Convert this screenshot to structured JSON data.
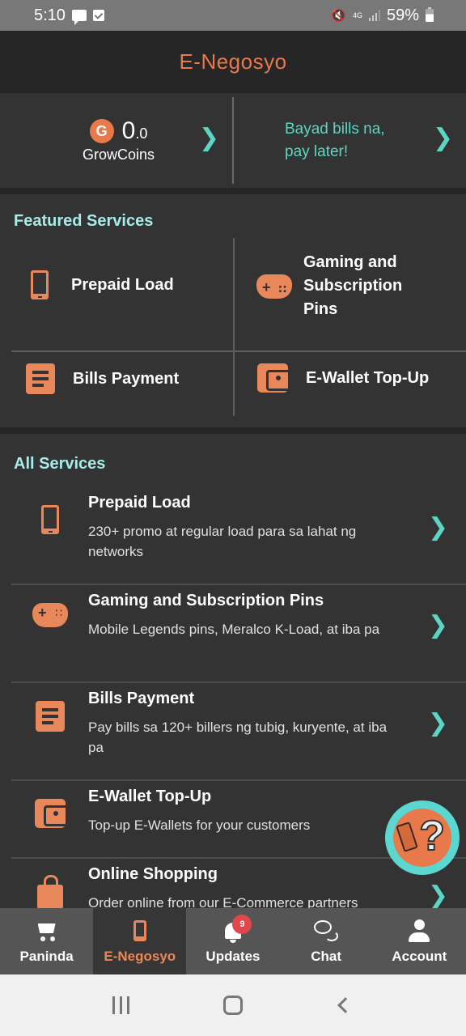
{
  "status_bar": {
    "time": "5:10",
    "network": "4G",
    "battery": "59%"
  },
  "header": {
    "title": "E-Negosyo"
  },
  "promo": {
    "coins_icon_letter": "G",
    "coins_value": "0",
    "coins_decimal": ".0",
    "coins_label": "GrowCoins",
    "paylater_text": "Bayad bills na,\npay later!"
  },
  "featured": {
    "title": "Featured Services",
    "items": [
      {
        "label": "Prepaid Load",
        "icon": "phone-icon"
      },
      {
        "label": "Gaming and\nSubscription\nPins",
        "icon": "gamepad-icon"
      },
      {
        "label": "Bills Payment",
        "icon": "bills-icon"
      },
      {
        "label": "E-Wallet Top-Up",
        "icon": "wallet-icon"
      }
    ]
  },
  "all_services": {
    "title": "All Services",
    "items": [
      {
        "title": "Prepaid Load",
        "desc": "230+ promo at regular load para sa lahat ng networks",
        "icon": "phone-icon"
      },
      {
        "title": "Gaming and Subscription Pins",
        "desc": "Mobile Legends pins, Meralco K-Load, at iba pa",
        "icon": "gamepad-icon"
      },
      {
        "title": "Bills Payment",
        "desc": "Pay bills sa 120+ billers ng tubig, kuryente, at iba pa",
        "icon": "bills-icon"
      },
      {
        "title": "E-Wallet Top-Up",
        "desc": "Top-up E-Wallets for your customers",
        "icon": "wallet-icon"
      },
      {
        "title": "Online Shopping",
        "desc": "Order online from our E-Commerce partners",
        "icon": "shopping-bag-icon"
      }
    ]
  },
  "help_fab": {
    "icon": "help-question-icon"
  },
  "bottom_nav": {
    "active": "E-Negosyo",
    "items": [
      {
        "label": "Paninda",
        "icon": "cart-icon"
      },
      {
        "label": "E-Negosyo",
        "icon": "phone-icon"
      },
      {
        "label": "Updates",
        "icon": "bell-icon",
        "badge": "9"
      },
      {
        "label": "Chat",
        "icon": "chat-icon"
      },
      {
        "label": "Account",
        "icon": "user-icon"
      }
    ]
  },
  "colors": {
    "accent_orange": "#e8794a",
    "accent_teal": "#5cd6c4",
    "section_title": "#a6ece8",
    "background": "#333333",
    "header_bg": "#262626",
    "nav_bg": "#555555",
    "badge_red": "#e0474c"
  }
}
